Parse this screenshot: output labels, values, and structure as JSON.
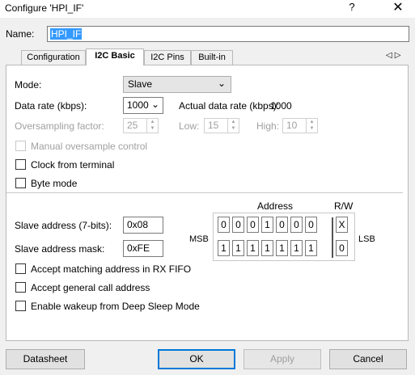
{
  "window": {
    "title": "Configure 'HPI_IF'",
    "help": "?",
    "close": "✕"
  },
  "name": {
    "label": "Name:",
    "value": "HPI_IF"
  },
  "tabs": [
    {
      "label": "Configuration"
    },
    {
      "label": "I2C Basic"
    },
    {
      "label": "I2C Pins"
    },
    {
      "label": "Built-in"
    }
  ],
  "tab_scroll": {
    "left": "◁",
    "right": "▷"
  },
  "form": {
    "mode": {
      "label": "Mode:",
      "value": "Slave"
    },
    "data_rate": {
      "label": "Data rate (kbps):",
      "value": "1000",
      "actual_label": "Actual data rate (kbps):",
      "actual_value": "1000"
    },
    "oversampling": {
      "label": "Oversampling factor:",
      "value": "25",
      "low_label": "Low:",
      "low_value": "15",
      "high_label": "High:",
      "high_value": "10"
    },
    "manual_oversample": {
      "label": "Manual oversample control",
      "checked": false
    },
    "clock_from_terminal": {
      "label": "Clock from terminal",
      "checked": false
    },
    "byte_mode": {
      "label": "Byte mode",
      "checked": false
    },
    "slave_address": {
      "label": "Slave address (7-bits):",
      "value": "0x08"
    },
    "slave_mask": {
      "label": "Slave address mask:",
      "value": "0xFE"
    },
    "accept_matching": {
      "label": "Accept matching address in RX FIFO",
      "checked": false
    },
    "accept_general": {
      "label": "Accept general call address",
      "checked": false
    },
    "enable_wakeup": {
      "label": "Enable wakeup from Deep Sleep Mode",
      "checked": false
    }
  },
  "bits": {
    "address_header": "Address",
    "rw_header": "R/W",
    "msb": "MSB",
    "lsb": "LSB",
    "address_row": [
      "0",
      "0",
      "0",
      "1",
      "0",
      "0",
      "0",
      "X"
    ],
    "mask_row": [
      "1",
      "1",
      "1",
      "1",
      "1",
      "1",
      "1",
      "0"
    ]
  },
  "buttons": {
    "datasheet": "Datasheet",
    "ok": "OK",
    "apply": "Apply",
    "cancel": "Cancel"
  },
  "icons": {
    "dropdown": "chevron-down-icon",
    "spin": "spin-arrows-icon"
  }
}
